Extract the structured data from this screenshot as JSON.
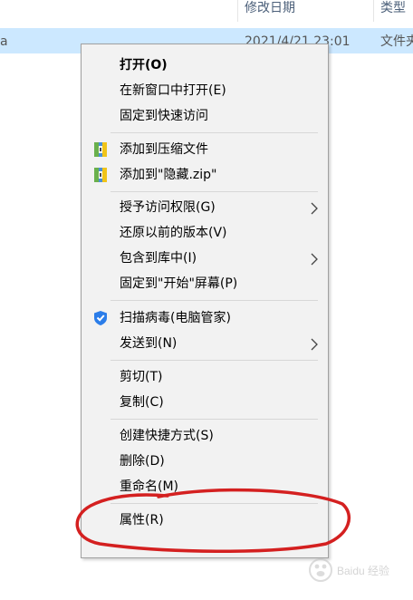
{
  "header": {
    "col_left_fragment": "",
    "modified_label": "修改日期",
    "type_label": "类型"
  },
  "file_row": {
    "name_fragment": "a",
    "modified_value": "2021/4/21 23:01",
    "type_value": "文件夹"
  },
  "menu": {
    "open": "打开(O)",
    "open_new_window": "在新窗口中打开(E)",
    "pin_quick_access": "固定到快速访问",
    "add_to_archive": "添加到压缩文件",
    "add_to_zip": "添加到\"隐藏.zip\"",
    "grant_access": "授予访问权限(G)",
    "restore_versions": "还原以前的版本(V)",
    "include_library": "包含到库中(I)",
    "pin_start": "固定到\"开始\"屏幕(P)",
    "scan_virus": "扫描病毒(电脑管家)",
    "send_to": "发送到(N)",
    "cut": "剪切(T)",
    "copy": "复制(C)",
    "create_shortcut": "创建快捷方式(S)",
    "delete": "删除(D)",
    "rename": "重命名(M)",
    "properties": "属性(R)"
  },
  "annotation": {
    "color": "#d42020"
  },
  "icons": {
    "archive": "winrar-archive-icon",
    "shield": "tencent-pc-manager-shield-icon",
    "submenu": "chevron-right-icon"
  },
  "watermark": "Baidu 经验"
}
